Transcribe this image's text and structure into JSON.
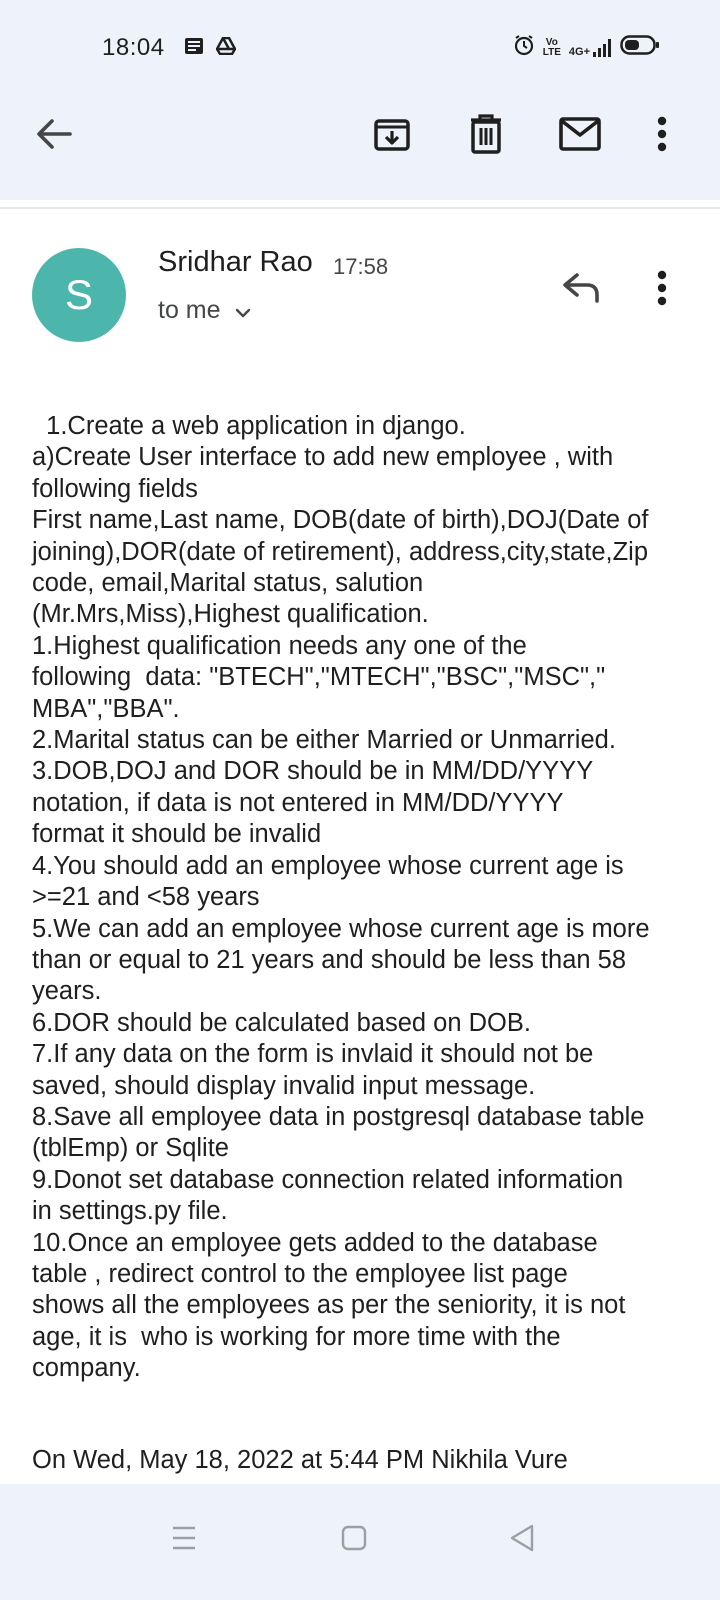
{
  "status_bar": {
    "time": "18:04",
    "notification_icons": [
      "notes-icon",
      "drive-icon"
    ],
    "volte_top": "Vo",
    "volte_bottom": "LTE",
    "network": "4G+",
    "right_icons": [
      "alarm-icon",
      "volte-icon",
      "signal-icon",
      "battery-icon"
    ]
  },
  "toolbar": {
    "icons": [
      "back-arrow-icon",
      "archive-icon",
      "delete-icon",
      "mark-unread-icon",
      "more-vert-icon"
    ]
  },
  "message": {
    "avatar_letter": "S",
    "avatar_color": "#4db6ac",
    "sender_name": "Sridhar Rao",
    "time": "17:58",
    "recipient": "to me",
    "actions": [
      "reply-icon",
      "more-vert-icon"
    ],
    "body_lines": [
      "  1.Create a web application in django.",
      "a)Create User interface to add new employee , with",
      "following fields",
      "First name,Last name, DOB(date of birth),DOJ(Date of",
      "joining),DOR(date of retirement), address,city,state,Zip",
      "code, email,Marital status, salution",
      "(Mr.Mrs,Miss),Highest qualification.",
      "1.Highest qualification needs any one of the",
      "following  data: \"BTECH\",\"MTECH\",\"BSC\",\"MSC\",\"",
      "MBA\",\"BBA\".",
      "2.Marital status can be either Married or Unmarried.",
      "3.DOB,DOJ and DOR should be in MM/DD/YYYY",
      "notation, if data is not entered in MM/DD/YYYY",
      "format it should be invalid",
      "4.You should add an employee whose current age is",
      ">=21 and <58 years",
      "5.We can add an employee whose current age is more",
      "than or equal to 21 years and should be less than 58",
      "years.",
      "6.DOR should be calculated based on DOB.",
      "7.If any data on the form is invlaid it should not be",
      "saved, should display invalid input message.",
      "8.Save all employee data in postgresql database table",
      "(tblEmp) or Sqlite",
      "9.Donot set database connection related information",
      "in settings.py file.",
      "10.Once an employee gets added to the database",
      "table , redirect control to the employee list page",
      "shows all the employees as per the seniority, it is not",
      "age, it is  who is working for more time with the",
      "company."
    ],
    "quote_header": "On Wed, May 18, 2022 at 5:44 PM Nikhila Vure"
  },
  "nav_bar": {
    "buttons": [
      "recents-icon",
      "home-icon",
      "back-triangle-icon"
    ]
  },
  "colors": {
    "top_background": "#eef2fa",
    "text": "#1f1f1f",
    "secondary_text": "#444746"
  }
}
